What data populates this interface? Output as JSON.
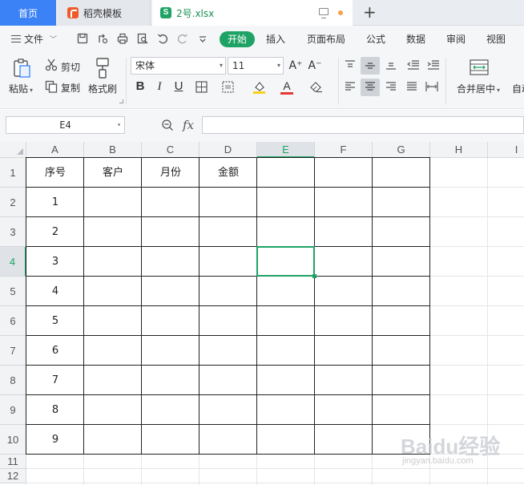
{
  "tabs": {
    "home": "首页",
    "template": "稻壳模板",
    "file": "2号.xlsx",
    "new_tab": "+"
  },
  "menu": {
    "file": "文件",
    "start": "开始",
    "insert": "插入",
    "page_layout": "页面布局",
    "formula": "公式",
    "data": "数据",
    "review": "审阅",
    "view": "视图"
  },
  "ribbon": {
    "paste": "粘贴",
    "cut": "剪切",
    "copy": "复制",
    "format_painter": "格式刷",
    "font_name": "宋体",
    "font_size": "11",
    "increase_font": "A⁺",
    "decrease_font": "A⁻",
    "bold": "B",
    "italic": "I",
    "underline": "U",
    "font_color_label": "A",
    "merge_center": "合并居中",
    "auto_wrap": "自动"
  },
  "formula_bar": {
    "name_box": "E4",
    "fx": "fx",
    "formula": ""
  },
  "sheet": {
    "columns": [
      "A",
      "B",
      "C",
      "D",
      "E",
      "F",
      "G",
      "H",
      "I"
    ],
    "rows": [
      "1",
      "2",
      "3",
      "4",
      "5",
      "6",
      "7",
      "8",
      "9",
      "10",
      "11",
      "12"
    ],
    "headers": [
      "序号",
      "客户",
      "月份",
      "金额"
    ],
    "serial_numbers": [
      "1",
      "2",
      "3",
      "4",
      "5",
      "6",
      "7",
      "8",
      "9"
    ],
    "active_cell": "E4"
  },
  "colors": {
    "accent": "#1fa365",
    "home_tab": "#3b82f6"
  },
  "watermark": {
    "title": "Baidu经验",
    "sub": "jingyan.baidu.com"
  }
}
